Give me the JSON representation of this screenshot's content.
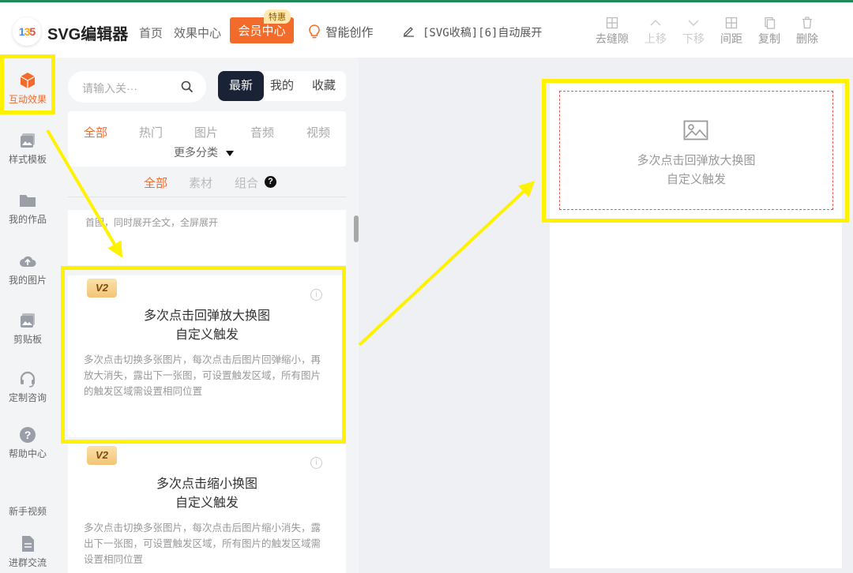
{
  "header": {
    "logo_text": "135",
    "brand": "SVG编辑器",
    "nav": [
      "首页",
      "效果中心"
    ],
    "vip_label": "会员中心",
    "vip_tag": "特惠",
    "ai_label": "智能创作",
    "draft_title": "[SVG收稿][6]自动展开",
    "tools": [
      {
        "label": "去缝隙",
        "icon": "grid-icon",
        "enabled": true
      },
      {
        "label": "上移",
        "icon": "chevron-up-icon",
        "enabled": false
      },
      {
        "label": "下移",
        "icon": "chevron-down-icon",
        "enabled": false
      },
      {
        "label": "间距",
        "icon": "spacing-icon",
        "enabled": true
      },
      {
        "label": "复制",
        "icon": "copy-icon",
        "enabled": true
      },
      {
        "label": "删除",
        "icon": "trash-icon",
        "enabled": true
      }
    ]
  },
  "sidebar": {
    "items": [
      {
        "label": "互动效果",
        "icon": "cube-icon",
        "active": true
      },
      {
        "label": "样式模板",
        "icon": "image-icon"
      },
      {
        "label": "我的作品",
        "icon": "folder-icon"
      },
      {
        "label": "我的图片",
        "icon": "cloud-upload-icon"
      },
      {
        "label": "剪贴板",
        "icon": "clipboard-icon"
      },
      {
        "label": "定制咨询",
        "icon": "headset-icon"
      },
      {
        "label": "帮助中心",
        "icon": "help-icon"
      },
      {
        "label": "新手视频",
        "icon": "video-icon"
      },
      {
        "label": "进群交流",
        "icon": "document-icon"
      }
    ]
  },
  "panel": {
    "search_placeholder": "请输入关···",
    "sort_tabs": [
      "最新",
      "我的",
      "收藏"
    ],
    "categories": [
      "全部",
      "热门",
      "图片",
      "音频",
      "视频"
    ],
    "more_categories": "更多分类",
    "sub_tabs": [
      "全部",
      "素材",
      "组合"
    ],
    "partial_text": "首图，同时展开全文，全屏展开",
    "cards": [
      {
        "badge": "V2",
        "title": "多次点击回弹放大换图",
        "subtitle": "自定义触发",
        "desc": "多次点击切换多张图片，每次点击后图片回弹缩小，再放大消失，露出下一张图，可设置触发区域，所有图片的触发区域需设置相同位置"
      },
      {
        "badge": "V2",
        "title": "多次点击缩小换图",
        "subtitle": "自定义触发",
        "desc": "多次点击切换多张图片，每次点击后图片缩小消失，露出下一张图，可设置触发区域，所有图片的触发区域需设置相同位置"
      }
    ]
  },
  "canvas": {
    "placeholder_title": "多次点击回弹放大换图",
    "placeholder_subtitle": "自定义触发"
  },
  "colors": {
    "accent": "#f26b2b",
    "highlight": "#fff200",
    "dark": "#1a2236",
    "topline": "#1e8b57"
  }
}
